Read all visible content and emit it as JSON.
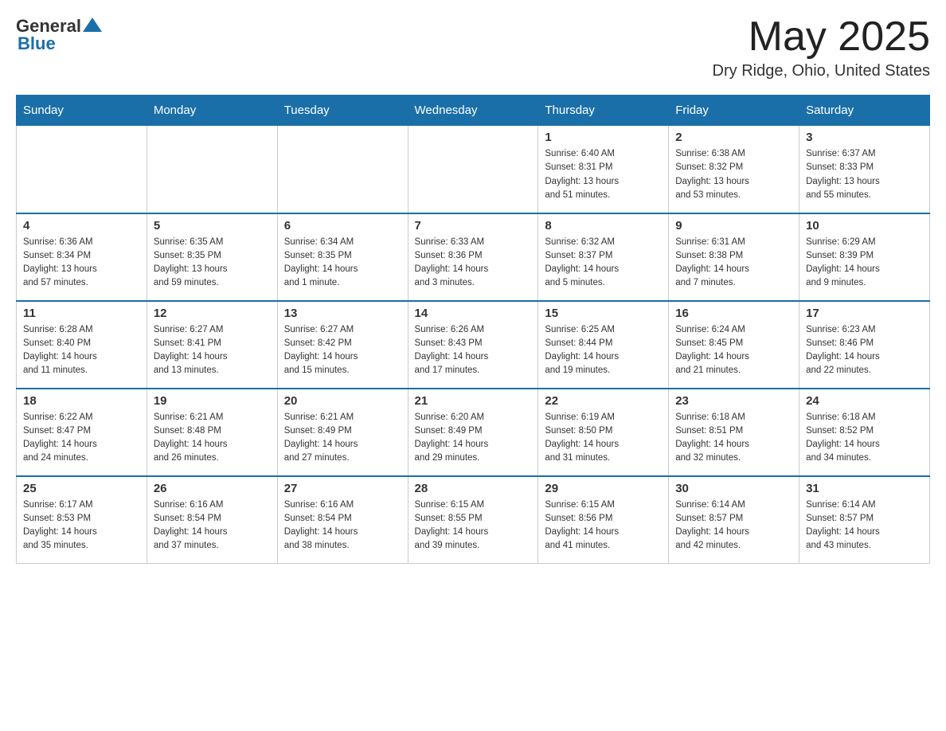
{
  "header": {
    "logo_general": "General",
    "logo_blue": "Blue",
    "month_title": "May 2025",
    "location": "Dry Ridge, Ohio, United States"
  },
  "weekdays": [
    "Sunday",
    "Monday",
    "Tuesday",
    "Wednesday",
    "Thursday",
    "Friday",
    "Saturday"
  ],
  "weeks": [
    [
      {
        "day": "",
        "info": ""
      },
      {
        "day": "",
        "info": ""
      },
      {
        "day": "",
        "info": ""
      },
      {
        "day": "",
        "info": ""
      },
      {
        "day": "1",
        "info": "Sunrise: 6:40 AM\nSunset: 8:31 PM\nDaylight: 13 hours\nand 51 minutes."
      },
      {
        "day": "2",
        "info": "Sunrise: 6:38 AM\nSunset: 8:32 PM\nDaylight: 13 hours\nand 53 minutes."
      },
      {
        "day": "3",
        "info": "Sunrise: 6:37 AM\nSunset: 8:33 PM\nDaylight: 13 hours\nand 55 minutes."
      }
    ],
    [
      {
        "day": "4",
        "info": "Sunrise: 6:36 AM\nSunset: 8:34 PM\nDaylight: 13 hours\nand 57 minutes."
      },
      {
        "day": "5",
        "info": "Sunrise: 6:35 AM\nSunset: 8:35 PM\nDaylight: 13 hours\nand 59 minutes."
      },
      {
        "day": "6",
        "info": "Sunrise: 6:34 AM\nSunset: 8:35 PM\nDaylight: 14 hours\nand 1 minute."
      },
      {
        "day": "7",
        "info": "Sunrise: 6:33 AM\nSunset: 8:36 PM\nDaylight: 14 hours\nand 3 minutes."
      },
      {
        "day": "8",
        "info": "Sunrise: 6:32 AM\nSunset: 8:37 PM\nDaylight: 14 hours\nand 5 minutes."
      },
      {
        "day": "9",
        "info": "Sunrise: 6:31 AM\nSunset: 8:38 PM\nDaylight: 14 hours\nand 7 minutes."
      },
      {
        "day": "10",
        "info": "Sunrise: 6:29 AM\nSunset: 8:39 PM\nDaylight: 14 hours\nand 9 minutes."
      }
    ],
    [
      {
        "day": "11",
        "info": "Sunrise: 6:28 AM\nSunset: 8:40 PM\nDaylight: 14 hours\nand 11 minutes."
      },
      {
        "day": "12",
        "info": "Sunrise: 6:27 AM\nSunset: 8:41 PM\nDaylight: 14 hours\nand 13 minutes."
      },
      {
        "day": "13",
        "info": "Sunrise: 6:27 AM\nSunset: 8:42 PM\nDaylight: 14 hours\nand 15 minutes."
      },
      {
        "day": "14",
        "info": "Sunrise: 6:26 AM\nSunset: 8:43 PM\nDaylight: 14 hours\nand 17 minutes."
      },
      {
        "day": "15",
        "info": "Sunrise: 6:25 AM\nSunset: 8:44 PM\nDaylight: 14 hours\nand 19 minutes."
      },
      {
        "day": "16",
        "info": "Sunrise: 6:24 AM\nSunset: 8:45 PM\nDaylight: 14 hours\nand 21 minutes."
      },
      {
        "day": "17",
        "info": "Sunrise: 6:23 AM\nSunset: 8:46 PM\nDaylight: 14 hours\nand 22 minutes."
      }
    ],
    [
      {
        "day": "18",
        "info": "Sunrise: 6:22 AM\nSunset: 8:47 PM\nDaylight: 14 hours\nand 24 minutes."
      },
      {
        "day": "19",
        "info": "Sunrise: 6:21 AM\nSunset: 8:48 PM\nDaylight: 14 hours\nand 26 minutes."
      },
      {
        "day": "20",
        "info": "Sunrise: 6:21 AM\nSunset: 8:49 PM\nDaylight: 14 hours\nand 27 minutes."
      },
      {
        "day": "21",
        "info": "Sunrise: 6:20 AM\nSunset: 8:49 PM\nDaylight: 14 hours\nand 29 minutes."
      },
      {
        "day": "22",
        "info": "Sunrise: 6:19 AM\nSunset: 8:50 PM\nDaylight: 14 hours\nand 31 minutes."
      },
      {
        "day": "23",
        "info": "Sunrise: 6:18 AM\nSunset: 8:51 PM\nDaylight: 14 hours\nand 32 minutes."
      },
      {
        "day": "24",
        "info": "Sunrise: 6:18 AM\nSunset: 8:52 PM\nDaylight: 14 hours\nand 34 minutes."
      }
    ],
    [
      {
        "day": "25",
        "info": "Sunrise: 6:17 AM\nSunset: 8:53 PM\nDaylight: 14 hours\nand 35 minutes."
      },
      {
        "day": "26",
        "info": "Sunrise: 6:16 AM\nSunset: 8:54 PM\nDaylight: 14 hours\nand 37 minutes."
      },
      {
        "day": "27",
        "info": "Sunrise: 6:16 AM\nSunset: 8:54 PM\nDaylight: 14 hours\nand 38 minutes."
      },
      {
        "day": "28",
        "info": "Sunrise: 6:15 AM\nSunset: 8:55 PM\nDaylight: 14 hours\nand 39 minutes."
      },
      {
        "day": "29",
        "info": "Sunrise: 6:15 AM\nSunset: 8:56 PM\nDaylight: 14 hours\nand 41 minutes."
      },
      {
        "day": "30",
        "info": "Sunrise: 6:14 AM\nSunset: 8:57 PM\nDaylight: 14 hours\nand 42 minutes."
      },
      {
        "day": "31",
        "info": "Sunrise: 6:14 AM\nSunset: 8:57 PM\nDaylight: 14 hours\nand 43 minutes."
      }
    ]
  ]
}
